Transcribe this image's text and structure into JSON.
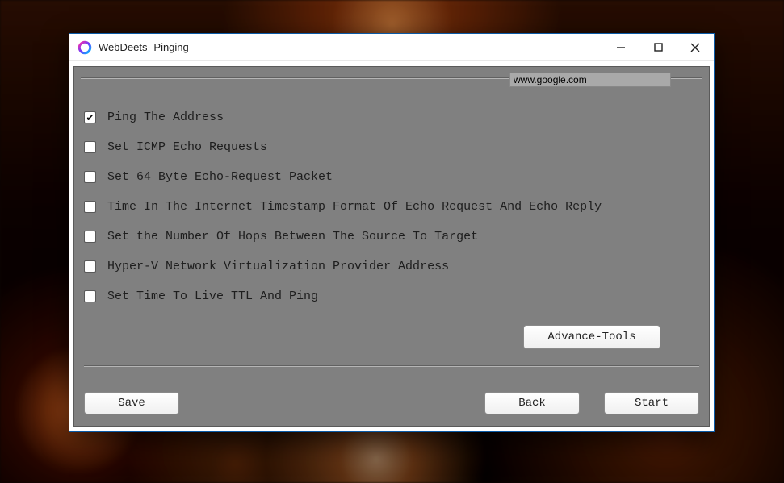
{
  "window": {
    "title": "WebDeets- Pinging"
  },
  "inputs": {
    "url_value": "www.google.com"
  },
  "options": [
    {
      "label": "Ping The Address",
      "checked": true
    },
    {
      "label": "Set ICMP Echo Requests",
      "checked": false
    },
    {
      "label": "Set 64 Byte Echo-Request Packet",
      "checked": false
    },
    {
      "label": "Time In The Internet Timestamp Format Of Echo Request And Echo Reply",
      "checked": false
    },
    {
      "label": "Set the Number Of Hops Between The Source To Target",
      "checked": false
    },
    {
      "label": "Hyper-V Network Virtualization Provider Address",
      "checked": false
    },
    {
      "label": "Set Time To Live TTL And Ping",
      "checked": false
    }
  ],
  "buttons": {
    "advance": "Advance-Tools",
    "save": "Save",
    "back": "Back",
    "start": "Start"
  }
}
